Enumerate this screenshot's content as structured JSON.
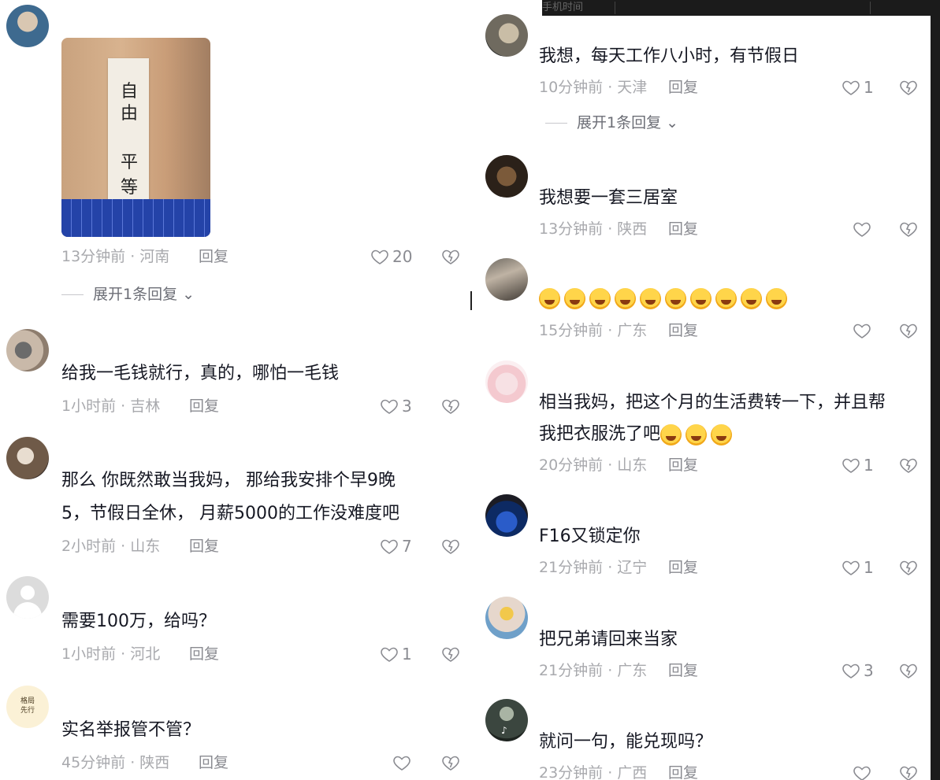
{
  "left": {
    "comments": [
      {
        "image_text": [
          "自",
          "由",
          "平",
          "等"
        ],
        "time": "13分钟前 · 河南",
        "reply": "回复",
        "likes": "20",
        "expand": "展开1条回复"
      },
      {
        "text": "给我一毛钱就行，真的，哪怕一毛钱",
        "time": "1小时前 · 吉林",
        "reply": "回复",
        "likes": "3"
      },
      {
        "text_line1": "那么 你既然敢当我妈，  那给我安排个早9晚",
        "text_line2": "5，节假日全休，  月薪5000的工作没难度吧",
        "time": "2小时前 · 山东",
        "reply": "回复",
        "likes": "7"
      },
      {
        "text": "需要100万，给吗？",
        "time": "1小时前 · 河北",
        "reply": "回复",
        "likes": "1"
      },
      {
        "avatar_text": "格局 先行",
        "text": "实名举报管不管？",
        "time": "45分钟前 · 陕西",
        "reply": "回复",
        "likes": ""
      }
    ]
  },
  "right": {
    "top_bar_text": "手机时间",
    "comments": [
      {
        "text": "我想，每天工作八小时，有节假日",
        "time": "10分钟前 · 天津",
        "reply": "回复",
        "likes": "1",
        "expand": "展开1条回复"
      },
      {
        "text": "我想要一套三居室",
        "time": "13分钟前 · 陕西",
        "reply": "回复",
        "likes": ""
      },
      {
        "emoji_count": 10,
        "emoji_name": "laughing-crying-emoji",
        "time": "15分钟前 · 广东",
        "reply": "回复",
        "likes": ""
      },
      {
        "text_line1": "相当我妈，把这个月的生活费转一下，并且帮",
        "text_line2": "我把衣服洗了吧",
        "emoji_count": 3,
        "time": "20分钟前 · 山东",
        "reply": "回复",
        "likes": "1"
      },
      {
        "text": "F16又锁定你",
        "time": "21分钟前 · 辽宁",
        "reply": "回复",
        "likes": "1"
      },
      {
        "text": "把兄弟请回来当家",
        "time": "21分钟前 · 广东",
        "reply": "回复",
        "likes": "3"
      },
      {
        "text": "就问一句，能兑现吗？",
        "time": "23分钟前 · 广西",
        "reply": "回复",
        "likes": "",
        "avatar_badge": "♪"
      }
    ]
  },
  "colors": {
    "text": "#161823",
    "meta": "#a8a9ad",
    "accent_gray": "#8a8b91"
  }
}
